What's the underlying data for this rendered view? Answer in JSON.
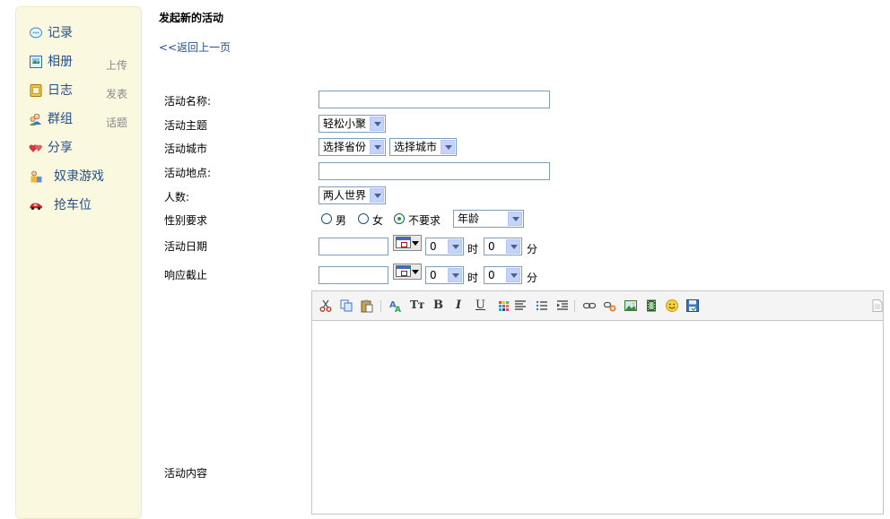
{
  "sidebar": {
    "items": [
      {
        "label": "记录",
        "sub": ""
      },
      {
        "label": "相册",
        "sub": "上传"
      },
      {
        "label": "日志",
        "sub": "发表"
      },
      {
        "label": "群组",
        "sub": "话题"
      },
      {
        "label": "分享",
        "sub": ""
      },
      {
        "label": "奴隶游戏",
        "sub": ""
      },
      {
        "label": "抢车位",
        "sub": ""
      }
    ]
  },
  "page": {
    "title": "发起新的活动",
    "back_link": "<<返回上一页"
  },
  "form": {
    "name_label": "活动名称:",
    "name_value": "",
    "theme_label": "活动主题",
    "theme_value": "轻松小聚",
    "city_label": "活动城市",
    "province_value": "选择省份",
    "city_value": "选择城市",
    "place_label": "活动地点:",
    "place_value": "",
    "people_label": "人数:",
    "people_value": "两人世界",
    "gender_label": "性别要求",
    "gender_options": [
      "男",
      "女",
      "不要求"
    ],
    "gender_selected": "不要求",
    "age_value": "年龄",
    "date_label": "活动日期",
    "deadline_label": "响应截止",
    "hour_value": "0",
    "minute_value": "0",
    "hour_unit": "时",
    "minute_unit": "分",
    "content_label": "活动内容"
  },
  "editor": {
    "toolbar_icons": [
      "cut-icon",
      "copy-icon",
      "paste-icon",
      "font-icon",
      "font-size-icon",
      "bold-icon",
      "italic-icon",
      "underline-icon",
      "color-icon",
      "align-left-icon",
      "list-icon",
      "indent-icon",
      "link-icon",
      "unlink-icon",
      "image-icon",
      "video-icon",
      "emoticon-icon",
      "save-icon",
      "source-icon"
    ],
    "bold_glyph": "B",
    "italic_glyph": "I",
    "underline_glyph": "U",
    "font_size_glyph": "Tт"
  }
}
